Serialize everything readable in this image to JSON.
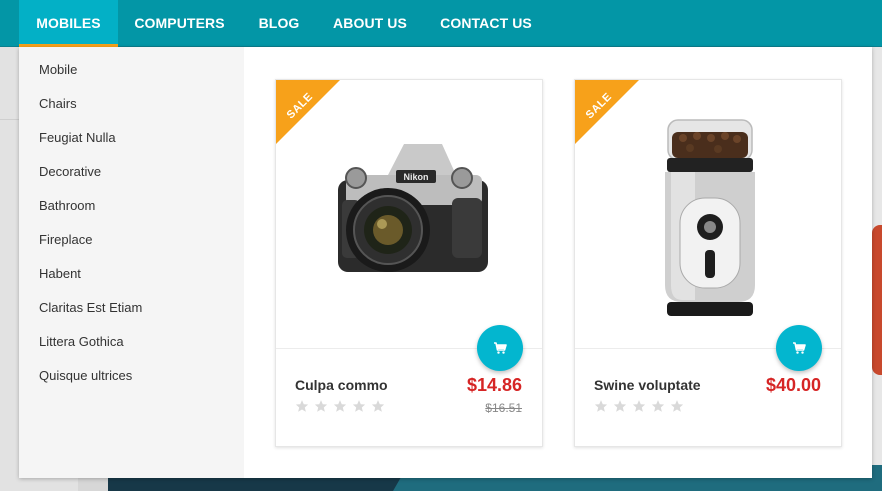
{
  "nav": {
    "items": [
      {
        "label": "MOBILES",
        "active": true
      },
      {
        "label": "COMPUTERS",
        "active": false
      },
      {
        "label": "BLOG",
        "active": false
      },
      {
        "label": "ABOUT US",
        "active": false
      },
      {
        "label": "CONTACT US",
        "active": false
      }
    ]
  },
  "categories": [
    "Mobile",
    "Chairs",
    "Feugiat Nulla",
    "Decorative",
    "Bathroom",
    "Fireplace",
    "Habent",
    "Claritas Est Etiam",
    "Littera Gothica",
    "Quisque ultrices"
  ],
  "products": [
    {
      "name": "Culpa commo",
      "price": "$14.86",
      "old_price": "$16.51",
      "badge": "SALE",
      "image": "camera",
      "rating": 0,
      "rating_max": 5
    },
    {
      "name": "Swine voluptate",
      "price": "$40.00",
      "old_price": "",
      "badge": "SALE",
      "image": "coffee-grinder",
      "rating": 0,
      "rating_max": 5
    }
  ],
  "colors": {
    "nav_bg": "#0396a6",
    "nav_active_bg": "#03b0c6",
    "accent_orange": "#f7a11a",
    "price_red": "#d62525",
    "cart_button": "#03b6cf"
  }
}
